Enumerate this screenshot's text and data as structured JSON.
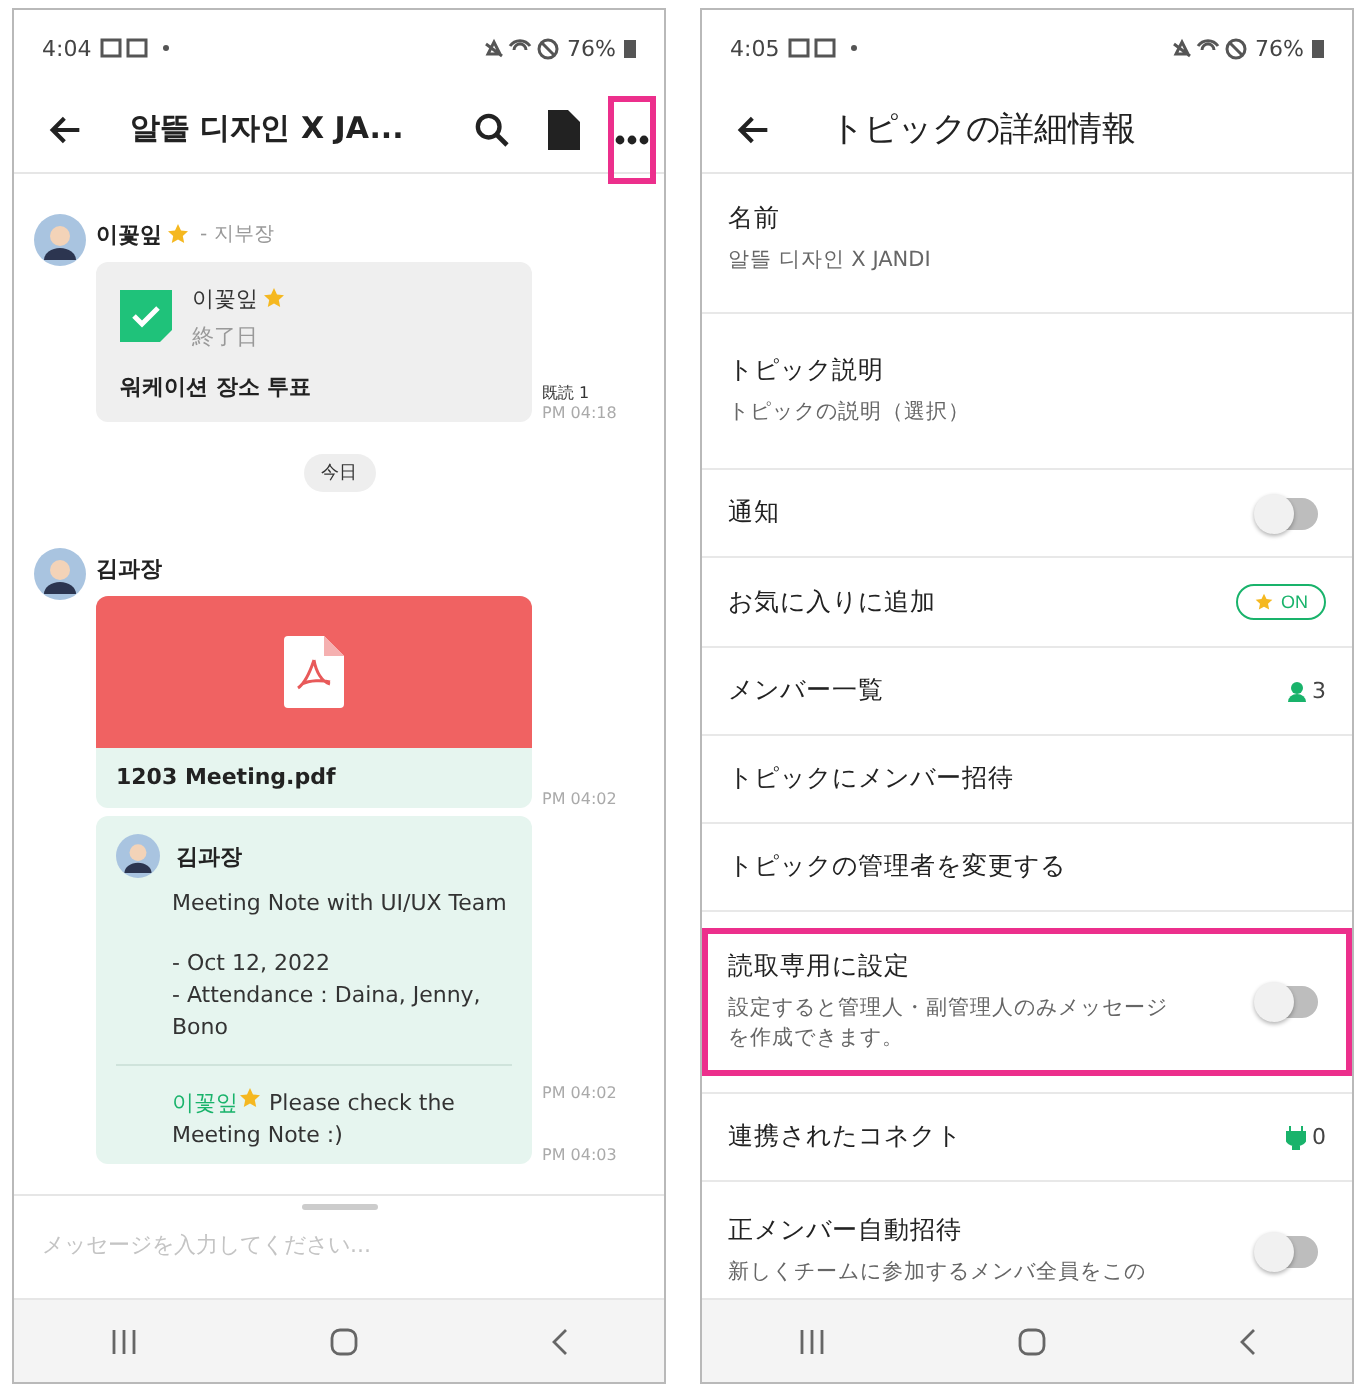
{
  "chat_screen": {
    "status_bar": {
      "time": "4:04",
      "battery": "76%"
    },
    "header": {
      "title": "알뜰 디자인 X JA...",
      "more_highlighted": true
    },
    "messages": [
      {
        "kind": "poll",
        "sender": "이꽃잎",
        "sender_star": true,
        "role": "- 지부장",
        "poll_author": "이꽃잎",
        "poll_author_star": true,
        "poll_status": "終了日",
        "poll_title": "워케이션 장소 투표",
        "read": "既読 1",
        "time": "PM 04:18"
      },
      {
        "kind": "date",
        "label": "今日"
      },
      {
        "kind": "file",
        "sender": "김과장",
        "file_name": "1203 Meeting.pdf",
        "time": "PM 04:02",
        "comments": [
          {
            "kind": "note",
            "author": "김과장",
            "paragraphs": [
              "Meeting Note with UI/UX Team",
              "- Oct 12, 2022\n- Attendance : Daina, Jenny, Bono"
            ],
            "time": "PM 04:02"
          },
          {
            "kind": "mention",
            "mention": "이꽃잎",
            "mention_star": true,
            "text": "Please check the Meeting Note :)",
            "time": "PM 04:03"
          }
        ]
      }
    ],
    "input": {
      "placeholder": "メッセージを入力してください..."
    }
  },
  "detail_screen": {
    "status_bar": {
      "time": "4:05",
      "battery": "76%"
    },
    "header": {
      "title": "トピックの詳細情報"
    },
    "items": [
      {
        "kind": "detail",
        "label": "名前",
        "value": "알뜰 디자인 X JANDI"
      },
      {
        "kind": "detail",
        "label": "トピック説明",
        "value": "トピックの説明（選択）"
      },
      {
        "kind": "toggle",
        "label": "通知",
        "on": false
      },
      {
        "kind": "favorite",
        "label": "お気に入りに追加",
        "badge": "ON"
      },
      {
        "kind": "member_count",
        "label": "メンバー一覧",
        "count": "3"
      },
      {
        "kind": "plain",
        "label": "トピックにメンバー招待"
      },
      {
        "kind": "plain",
        "label": "トピックの管理者を変更する"
      },
      {
        "kind": "toggle",
        "label": "読取専用に設定",
        "description": "設定すると管理人・副管理人のみメッセージを作成できます。",
        "on": false,
        "highlighted": true
      },
      {
        "kind": "connect_count",
        "label": "連携されたコネクト",
        "count": "0"
      },
      {
        "kind": "toggle",
        "label": "正メンバー自動招待",
        "description": "新しくチームに参加するメンバ全員をこの",
        "on": false
      }
    ]
  }
}
